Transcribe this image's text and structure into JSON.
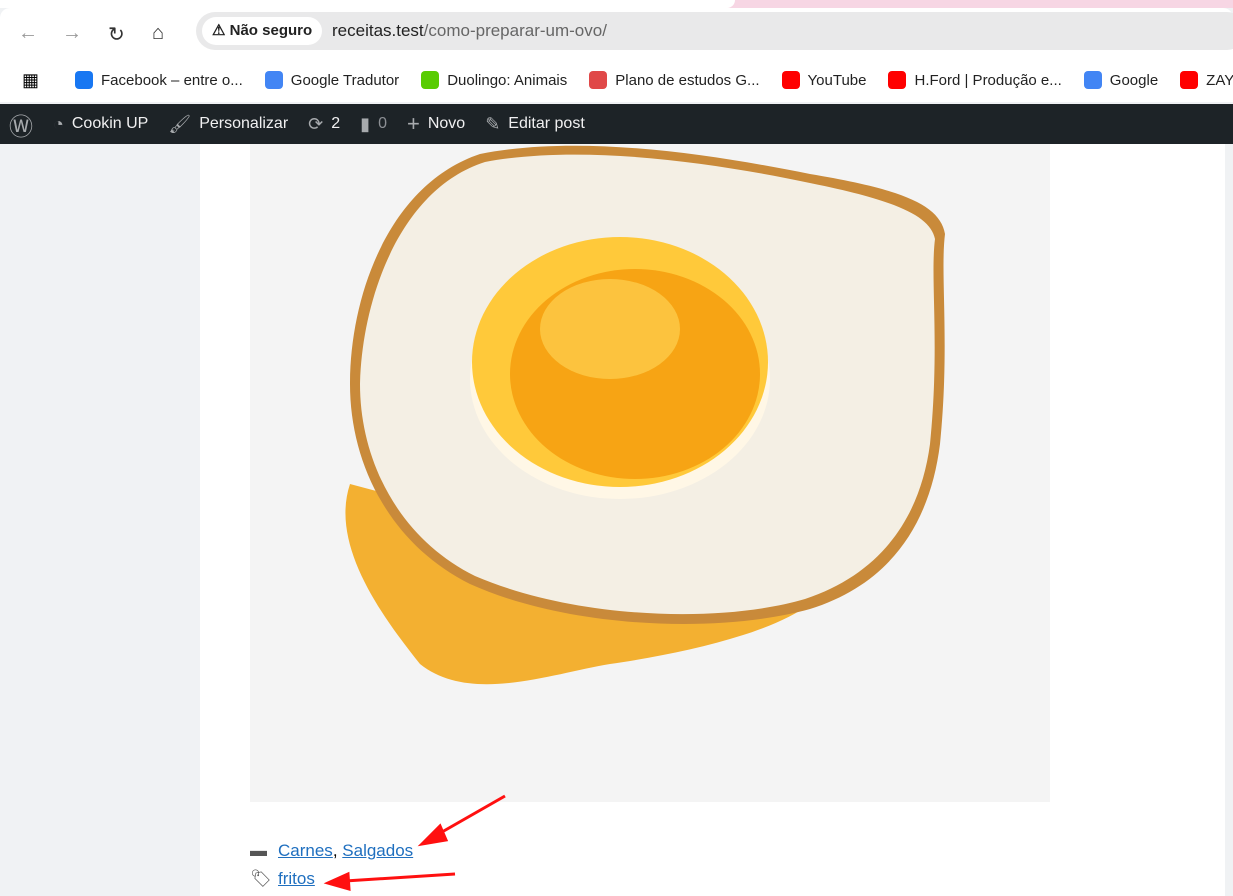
{
  "browser": {
    "security_chip": "Não seguro",
    "url_host": "receitas.test",
    "url_path": "/como-preparar-um-ovo/",
    "bookmarks": [
      {
        "label": "Facebook – entre o...",
        "color": "#1877f2"
      },
      {
        "label": "Google Tradutor",
        "color": "#4285f4"
      },
      {
        "label": "Duolingo: Animais",
        "color": "#58cc02"
      },
      {
        "label": "Plano de estudos G...",
        "color": "#e04848"
      },
      {
        "label": "YouTube",
        "color": "#ff0000"
      },
      {
        "label": "H.Ford | Produção e...",
        "color": "#ff0000"
      },
      {
        "label": "Google",
        "color": "#4285f4"
      },
      {
        "label": "ZAY",
        "color": "#ff0000"
      }
    ]
  },
  "adminbar": {
    "site": "Cookin UP",
    "customize": "Personalizar",
    "updates": "2",
    "comments": "0",
    "new": "Novo",
    "edit": "Editar post"
  },
  "post": {
    "categories": [
      "Carnes",
      "Salgados"
    ],
    "category_separator": ",",
    "tags": [
      "fritos"
    ]
  },
  "colors": {
    "link": "#1f6fbf",
    "adminbar": "#1d2327",
    "annotation_arrow": "#ff0000"
  }
}
